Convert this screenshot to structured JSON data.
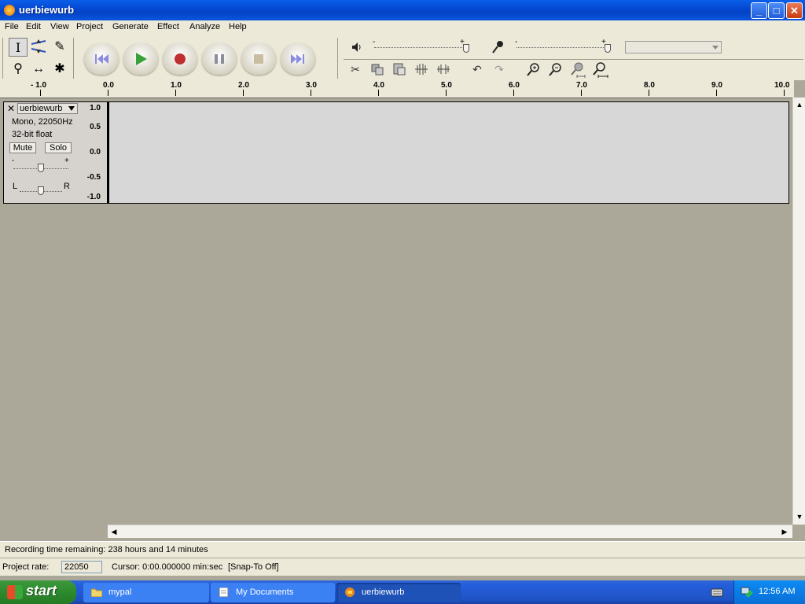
{
  "window": {
    "title": "uerbiewurb",
    "min_label": "_",
    "max_label": "□",
    "close_label": "✕"
  },
  "menu": [
    "File",
    "Edit",
    "View",
    "Project",
    "Generate",
    "Effect",
    "Analyze",
    "Help"
  ],
  "tools": {
    "selection": "I",
    "envelope": "envelope-icon",
    "draw": "✎",
    "zoom": "⚲",
    "timeshift": "↔",
    "multi": "✱"
  },
  "transport": [
    "skip-start",
    "play",
    "record",
    "pause",
    "stop",
    "skip-end"
  ],
  "meters": {
    "output_minus": "-",
    "output_plus": "+",
    "input_minus": "-",
    "input_plus": "+",
    "output_level": 1.0,
    "input_level": 1.0
  },
  "ruler": {
    "labels": [
      "- 1.0",
      "0.0",
      "1.0",
      "2.0",
      "3.0",
      "4.0",
      "5.0",
      "6.0",
      "7.0",
      "8.0",
      "9.0",
      "10.0"
    ]
  },
  "track": {
    "name": "uerbiewurb",
    "format": "Mono, 22050Hz",
    "bits": "32-bit float",
    "mute": "Mute",
    "solo": "Solo",
    "gain_minus": "-",
    "gain_plus": "+",
    "pan_left": "L",
    "pan_right": "R",
    "vruler": [
      "1.0",
      "0.5",
      "0.0",
      "-0.5",
      "-1.0"
    ]
  },
  "status": {
    "recording": "Recording time remaining: 238 hours and 14 minutes",
    "rate_label": "Project rate:",
    "rate_value": "22050",
    "cursor": "Cursor: 0:00.000000 min:sec",
    "snap": "[Snap-To Off]"
  },
  "taskbar": {
    "start": "start",
    "items": [
      "mypal",
      "My Documents",
      "uerbiewurb"
    ],
    "clock": "12:56 AM"
  },
  "colors": {
    "play": "#3aa13a",
    "record": "#c03030",
    "transport_gray": "#8c8c8c",
    "skip": "#6c6cd8"
  }
}
